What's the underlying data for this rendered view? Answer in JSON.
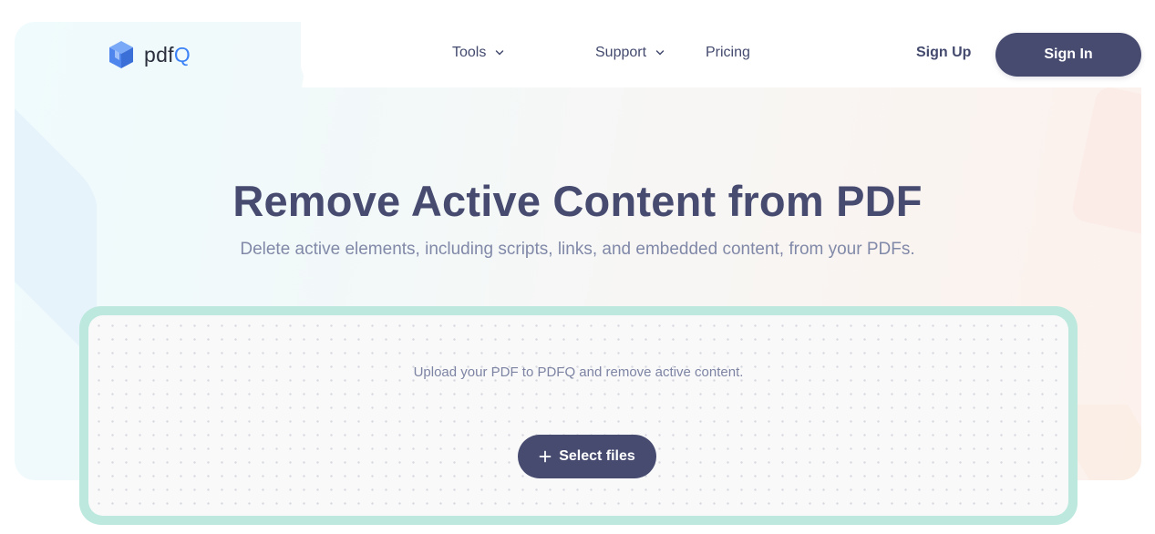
{
  "brand": {
    "name_prefix": "pdf",
    "name_suffix": "Q",
    "accent": "#3b82f6"
  },
  "nav": {
    "tools_label": "Tools",
    "support_label": "Support",
    "pricing_label": "Pricing",
    "signup_label": "Sign Up",
    "signin_label": "Sign In"
  },
  "hero": {
    "title": "Remove Active Content from PDF",
    "subtitle": "Delete active elements, including scripts, links, and embedded content, from your PDFs."
  },
  "upload": {
    "prompt": "Upload your PDF to PDFQ and remove active content.",
    "button_label": "Select files"
  },
  "colors": {
    "primary": "#474b70",
    "dropzone_border": "#bce8dd"
  },
  "icons": [
    "cube-logo-icon",
    "chevron-down-icon",
    "plus-icon"
  ]
}
